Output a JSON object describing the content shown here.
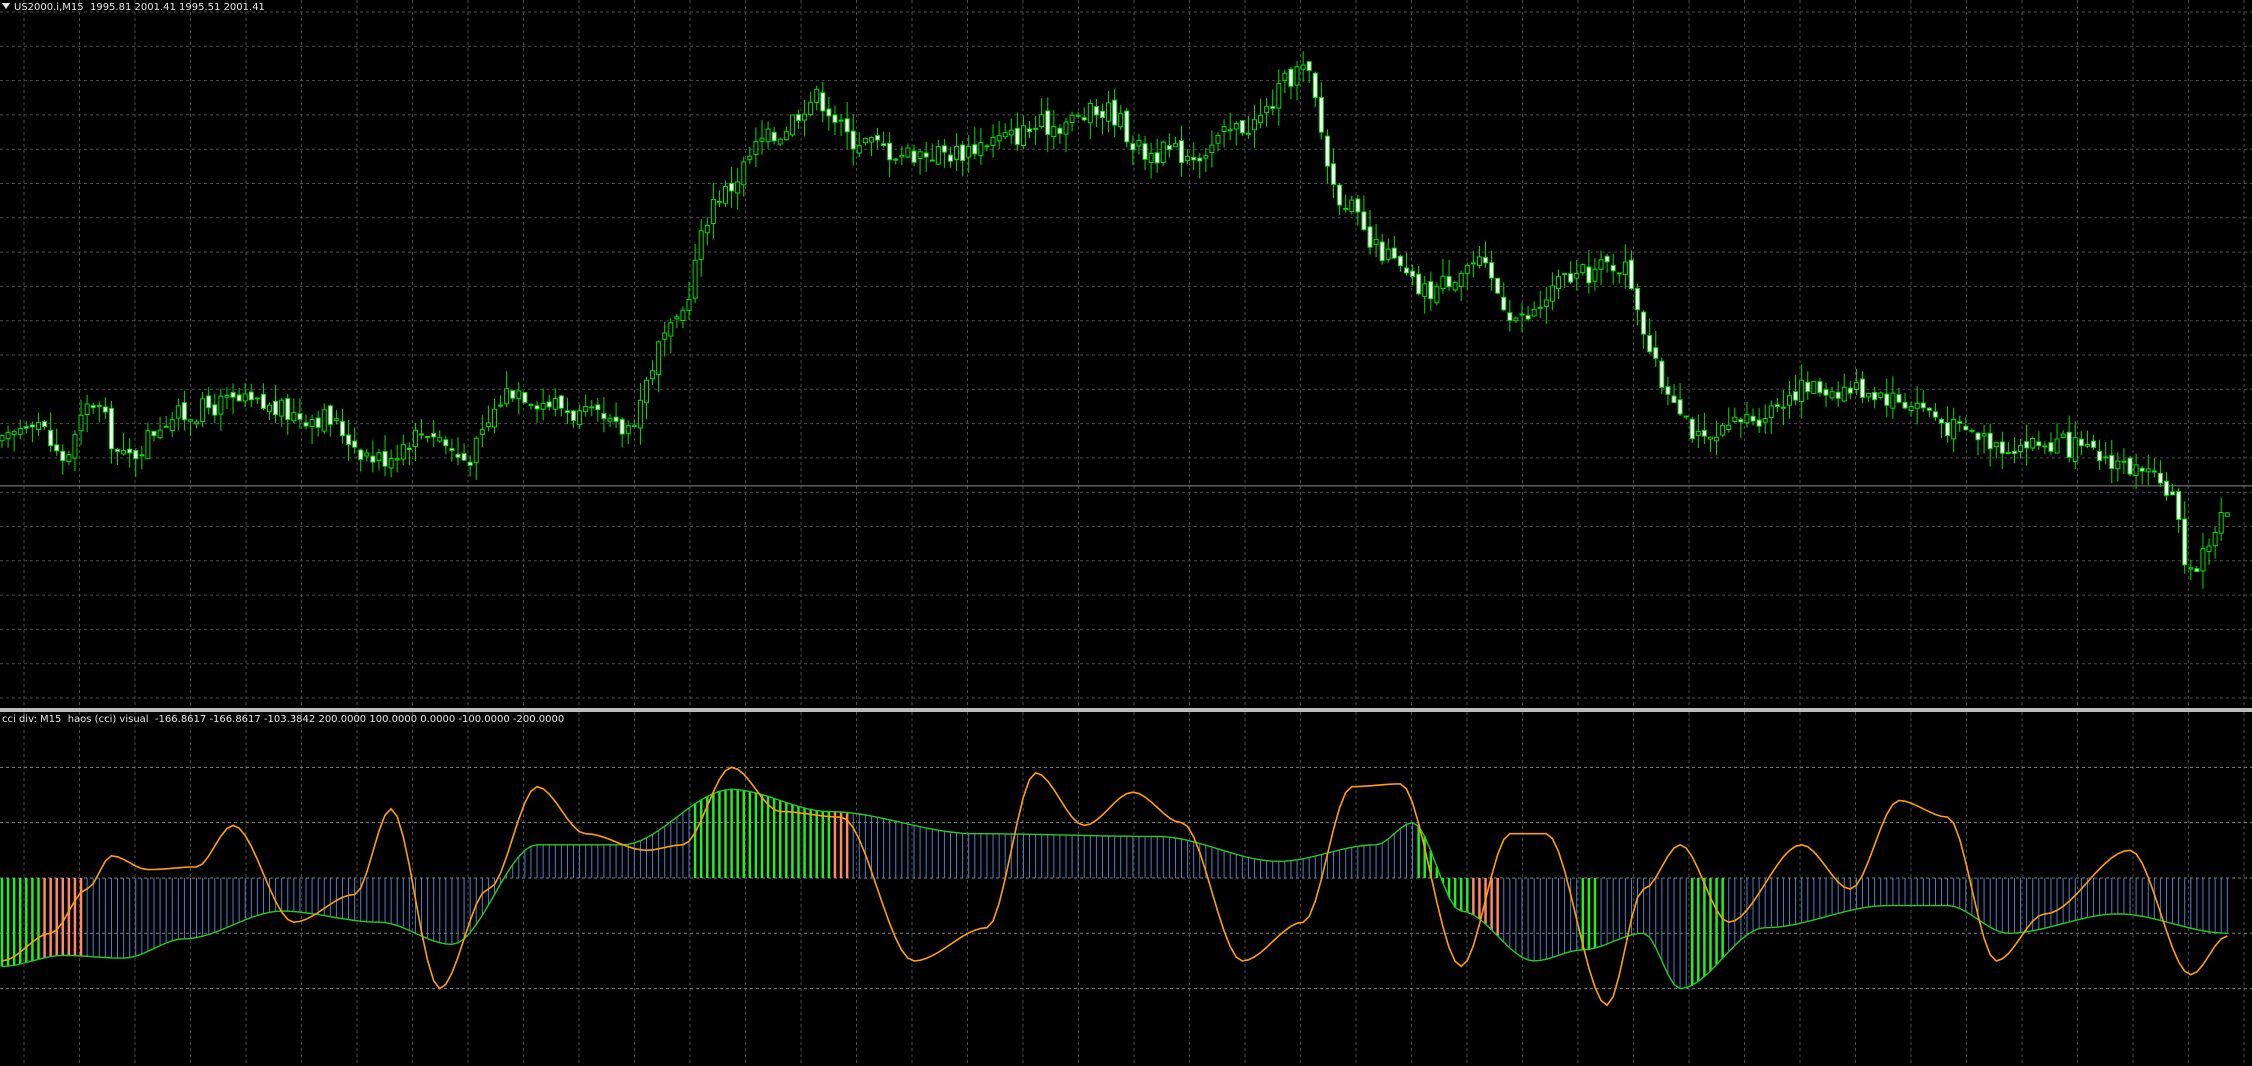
{
  "main_title": {
    "symbol_tf": "US2000.i,M15",
    "ohlc": "1995.81 2001.41 1995.51 2001.41"
  },
  "indicator_title": "cci div: M15  haos (cci) visual  -166.8617 -166.8617 -103.3842 200.0000 100.0000 0.0000 -100.0000 -200.0000",
  "colors": {
    "background": "#000000",
    "grid": "#4a4a4a",
    "candle": "#00e000",
    "bull_body": "#000000",
    "bear_body": "#ffffff",
    "cci_line": "#ffa000",
    "signal_line": "#22cc22",
    "hist_bull": "#22ee22",
    "hist_bear": "#ff8866",
    "hist_neutral": "#4f7fd0",
    "level_line": "#808080"
  },
  "chart_data": [
    {
      "type": "candlestick",
      "symbol": "US2000.i",
      "timeframe": "M15",
      "ylim": [
        1985,
        2036
      ],
      "current_price_level": 2001.0,
      "close_path_anchors": [
        [
          0,
          2004
        ],
        [
          5,
          2006
        ],
        [
          10,
          2003
        ],
        [
          15,
          2007
        ],
        [
          20,
          2003
        ],
        [
          28,
          2006
        ],
        [
          38,
          2007
        ],
        [
          52,
          2006
        ],
        [
          62,
          2003
        ],
        [
          70,
          2005
        ],
        [
          76,
          2003
        ],
        [
          84,
          2008
        ],
        [
          90,
          2007
        ],
        [
          96,
          2006
        ],
        [
          102,
          2005
        ],
        [
          110,
          2012
        ],
        [
          118,
          2022
        ],
        [
          126,
          2026
        ],
        [
          134,
          2029
        ],
        [
          140,
          2026
        ],
        [
          148,
          2025
        ],
        [
          156,
          2025
        ],
        [
          164,
          2026
        ],
        [
          172,
          2027
        ],
        [
          182,
          2028
        ],
        [
          188,
          2025
        ],
        [
          196,
          2025
        ],
        [
          205,
          2027
        ],
        [
          214,
          2031
        ],
        [
          220,
          2022
        ],
        [
          226,
          2018
        ],
        [
          234,
          2015
        ],
        [
          242,
          2017
        ],
        [
          250,
          2013
        ],
        [
          258,
          2016
        ],
        [
          266,
          2017
        ],
        [
          274,
          2008
        ],
        [
          280,
          2004
        ],
        [
          288,
          2006
        ],
        [
          296,
          2008
        ],
        [
          306,
          2008
        ],
        [
          314,
          2007
        ],
        [
          322,
          2005
        ],
        [
          330,
          2004
        ],
        [
          338,
          2004
        ],
        [
          346,
          2003
        ],
        [
          356,
          2001
        ],
        [
          360,
          1995
        ],
        [
          366,
          1999
        ]
      ]
    },
    {
      "type": "line_histogram",
      "name": "haos (cci) visual",
      "levels": [
        200,
        100,
        0,
        -100,
        -200
      ],
      "ylim": [
        -340,
        300
      ],
      "cci_path_anchors": [
        [
          0,
          -150
        ],
        [
          8,
          -100
        ],
        [
          14,
          -20
        ],
        [
          18,
          40
        ],
        [
          24,
          15
        ],
        [
          32,
          20
        ],
        [
          38,
          95
        ],
        [
          48,
          -80
        ],
        [
          58,
          -30
        ],
        [
          64,
          125
        ],
        [
          72,
          -200
        ],
        [
          80,
          -20
        ],
        [
          88,
          165
        ],
        [
          96,
          80
        ],
        [
          106,
          50
        ],
        [
          112,
          60
        ],
        [
          120,
          200
        ],
        [
          128,
          120
        ],
        [
          138,
          110
        ],
        [
          150,
          -150
        ],
        [
          162,
          -90
        ],
        [
          170,
          190
        ],
        [
          178,
          95
        ],
        [
          186,
          155
        ],
        [
          194,
          100
        ],
        [
          204,
          -150
        ],
        [
          214,
          -80
        ],
        [
          222,
          165
        ],
        [
          230,
          170
        ],
        [
          240,
          -160
        ],
        [
          248,
          80
        ],
        [
          254,
          80
        ],
        [
          264,
          -230
        ],
        [
          270,
          -20
        ],
        [
          276,
          60
        ],
        [
          284,
          -80
        ],
        [
          296,
          60
        ],
        [
          304,
          -20
        ],
        [
          312,
          140
        ],
        [
          320,
          110
        ],
        [
          328,
          -150
        ],
        [
          336,
          -65
        ],
        [
          350,
          50
        ],
        [
          360,
          -175
        ],
        [
          366,
          -105
        ]
      ],
      "signal_path_anchors": [
        [
          0,
          -160
        ],
        [
          10,
          -140
        ],
        [
          20,
          -145
        ],
        [
          30,
          -110
        ],
        [
          46,
          -60
        ],
        [
          62,
          -80
        ],
        [
          74,
          -120
        ],
        [
          88,
          60
        ],
        [
          102,
          60
        ],
        [
          120,
          160
        ],
        [
          136,
          120
        ],
        [
          160,
          80
        ],
        [
          190,
          75
        ],
        [
          210,
          30
        ],
        [
          226,
          60
        ],
        [
          232,
          100
        ],
        [
          240,
          -60
        ],
        [
          252,
          -150
        ],
        [
          260,
          -130
        ],
        [
          270,
          -100
        ],
        [
          276,
          -200
        ],
        [
          290,
          -90
        ],
        [
          310,
          -50
        ],
        [
          320,
          -50
        ],
        [
          330,
          -100
        ],
        [
          348,
          -65
        ],
        [
          366,
          -100
        ]
      ],
      "histogram_segments": [
        {
          "from": 0,
          "to": 7,
          "state": "bull"
        },
        {
          "from": 7,
          "to": 14,
          "state": "bear"
        },
        {
          "from": 14,
          "to": 114,
          "state": "neutral"
        },
        {
          "from": 114,
          "to": 137,
          "state": "bull"
        },
        {
          "from": 137,
          "to": 140,
          "state": "bear"
        },
        {
          "from": 140,
          "to": 233,
          "state": "neutral"
        },
        {
          "from": 233,
          "to": 242,
          "state": "bull"
        },
        {
          "from": 242,
          "to": 247,
          "state": "bear"
        },
        {
          "from": 247,
          "to": 260,
          "state": "neutral"
        },
        {
          "from": 260,
          "to": 263,
          "state": "bull"
        },
        {
          "from": 263,
          "to": 278,
          "state": "neutral"
        },
        {
          "from": 278,
          "to": 284,
          "state": "bull"
        },
        {
          "from": 284,
          "to": 367,
          "state": "neutral"
        }
      ]
    }
  ]
}
